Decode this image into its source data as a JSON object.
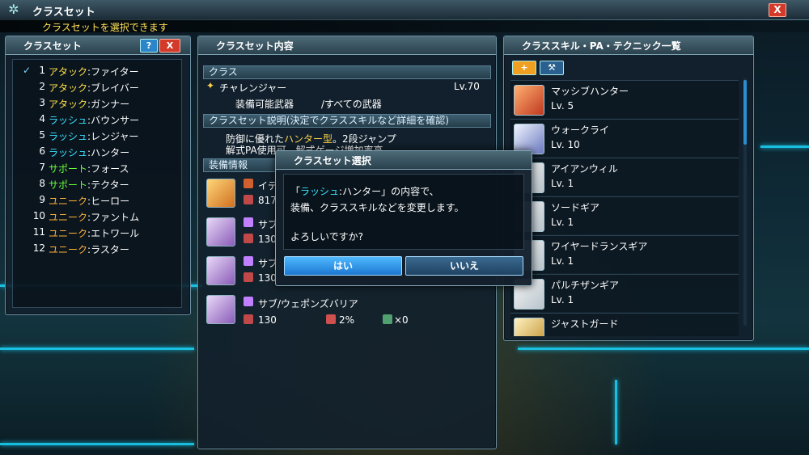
{
  "topbar": {
    "title": "クラスセット",
    "subtitle": "クラスセットを選択できます",
    "close_label": "X"
  },
  "class_list": {
    "title": "クラスセット",
    "help_label": "?",
    "close_label": "X",
    "items": [
      {
        "num": "1",
        "category": "アタック",
        "sep": ":",
        "name": "ファイター",
        "cat_color": "yellow",
        "selected": true
      },
      {
        "num": "2",
        "category": "アタック",
        "sep": ":",
        "name": "ブレイバー",
        "cat_color": "yellow"
      },
      {
        "num": "3",
        "category": "アタック",
        "sep": ":",
        "name": "ガンナー",
        "cat_color": "yellow"
      },
      {
        "num": "4",
        "category": "ラッシュ",
        "sep": ":",
        "name": "バウンサー",
        "cat_color": "cyan"
      },
      {
        "num": "5",
        "category": "ラッシュ",
        "sep": ":",
        "name": "レンジャー",
        "cat_color": "cyan"
      },
      {
        "num": "6",
        "category": "ラッシュ",
        "sep": ":",
        "name": "ハンター",
        "cat_color": "cyan"
      },
      {
        "num": "7",
        "category": "サポート",
        "sep": ":",
        "name": "フォース",
        "cat_color": "green"
      },
      {
        "num": "8",
        "category": "サポート",
        "sep": ":",
        "name": "テクター",
        "cat_color": "green"
      },
      {
        "num": "9",
        "category": "ユニーク",
        "sep": ":",
        "name": "ヒーロー",
        "cat_color": "orange"
      },
      {
        "num": "10",
        "category": "ユニーク",
        "sep": ":",
        "name": "ファントム",
        "cat_color": "orange"
      },
      {
        "num": "11",
        "category": "ユニーク",
        "sep": ":",
        "name": "エトワール",
        "cat_color": "orange"
      },
      {
        "num": "12",
        "category": "ユニーク",
        "sep": ":",
        "name": "ラスター",
        "cat_color": "orange"
      }
    ]
  },
  "details": {
    "title": "クラスセット内容",
    "class_section": "クラス",
    "class_name": "チャレンジャー",
    "level": "Lv.70",
    "weapons_label": "装備可能武器",
    "weapons_value": "/すべての武器",
    "desc_section": "クラスセット説明(決定でクラススキルなど詳細を確認)",
    "desc_line1_pre": "防御に優れた",
    "desc_line1_hl": "ハンター型",
    "desc_line1_post": "。2段ジャンプ",
    "desc_line2": "解式PA使用可。解式ゲージ増加率高",
    "equip_section": "装備情報",
    "equip": [
      {
        "name": "イデ",
        "stat": "817"
      },
      {
        "name": "サブ",
        "stat": "130"
      },
      {
        "name": "サブ",
        "stat": "130"
      },
      {
        "name": "サブ/ウェポンズバリア",
        "stat": "130",
        "extra1": "2%",
        "extra2": "×0"
      }
    ]
  },
  "skills": {
    "title": "クラススキル・PA・テクニック一覧",
    "tab1": "+",
    "tab2": "⚒",
    "items": [
      {
        "name": "マッシブハンター",
        "level": "Lv. 5"
      },
      {
        "name": "ウォークライ",
        "level": "Lv. 10"
      },
      {
        "name": "アイアンウィル",
        "level": "Lv. 1"
      },
      {
        "name": "ソードギア",
        "level": "Lv. 1"
      },
      {
        "name": "ワイヤードランスギア",
        "level": "Lv. 1"
      },
      {
        "name": "パルチザンギア",
        "level": "Lv. 1"
      },
      {
        "name": "ジャストガード",
        "level": ""
      }
    ]
  },
  "dialog": {
    "title": "クラスセット選択",
    "line1_open": "「",
    "line1_hl": "ラッシュ",
    "line1_mid": ":ハンター」の内容で、",
    "line2": "装備、クラススキルなどを変更します。",
    "line3": "よろしいですか?",
    "yes_label": "はい",
    "no_label": "いいえ"
  }
}
